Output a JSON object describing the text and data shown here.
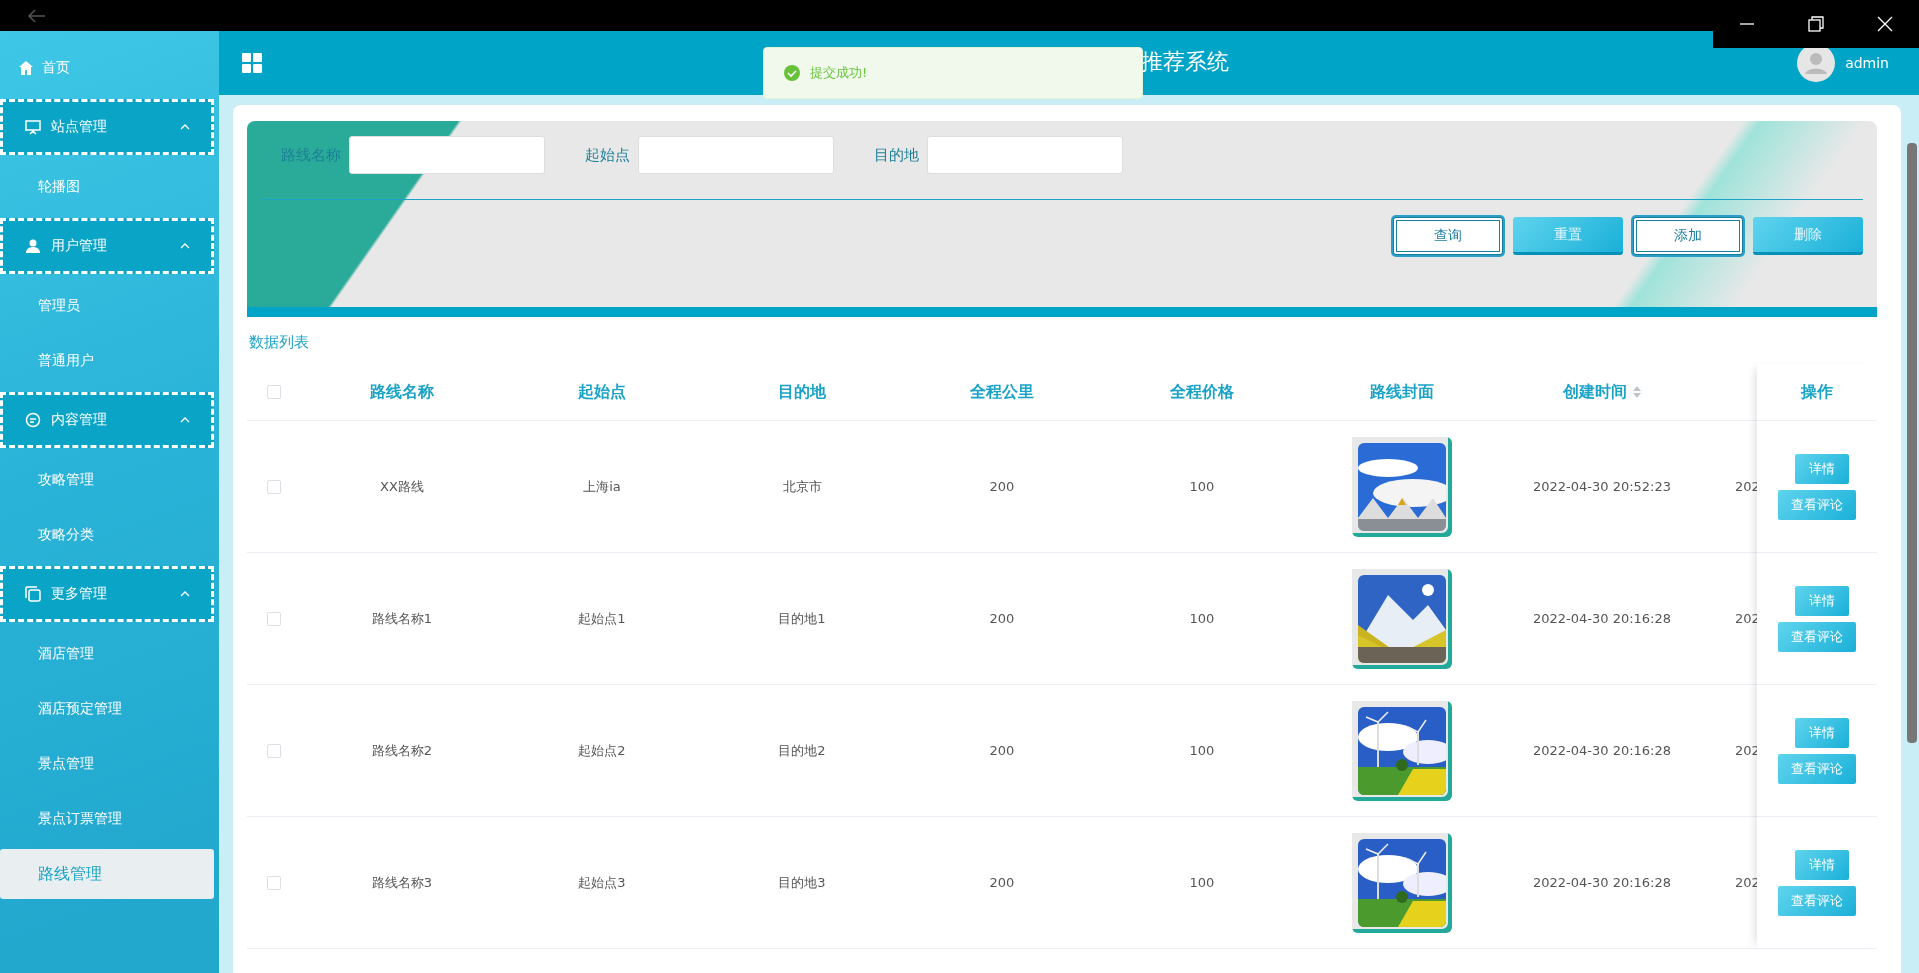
{
  "header": {
    "title": "推荐系统",
    "user": "admin"
  },
  "toast": {
    "kind": "success",
    "text": "提交成功!"
  },
  "sidebar": {
    "items": [
      {
        "kind": "link",
        "label": "首页"
      },
      {
        "kind": "group",
        "label": "站点管理",
        "expanded": true,
        "children": [
          {
            "label": "轮播图",
            "selected": false
          }
        ]
      },
      {
        "kind": "group",
        "label": "用户管理",
        "expanded": true,
        "children": [
          {
            "label": "管理员",
            "selected": false
          },
          {
            "label": "普通用户",
            "selected": false
          }
        ]
      },
      {
        "kind": "group",
        "label": "内容管理",
        "expanded": true,
        "children": [
          {
            "label": "攻略管理",
            "selected": false
          },
          {
            "label": "攻略分类",
            "selected": false
          }
        ]
      },
      {
        "kind": "group",
        "label": "更多管理",
        "expanded": true,
        "children": [
          {
            "label": "酒店管理",
            "selected": false
          },
          {
            "label": "酒店预定管理",
            "selected": false
          },
          {
            "label": "景点管理",
            "selected": false
          },
          {
            "label": "景点订票管理",
            "selected": false
          },
          {
            "label": "路线管理",
            "selected": true
          }
        ]
      }
    ]
  },
  "search": {
    "fields": [
      {
        "label": "路线名称"
      },
      {
        "label": "起始点"
      },
      {
        "label": "目的地"
      }
    ],
    "buttons": [
      {
        "label": "查询",
        "kind": "outline"
      },
      {
        "label": "重置",
        "kind": "filled"
      },
      {
        "label": "添加",
        "kind": "outline"
      },
      {
        "label": "删除",
        "kind": "filled"
      }
    ]
  },
  "table": {
    "title": "数据列表",
    "all_checked": false,
    "columns": [
      {
        "label": "路线名称"
      },
      {
        "label": "起始点"
      },
      {
        "label": "目的地"
      },
      {
        "label": "全程公里"
      },
      {
        "label": "全程价格"
      },
      {
        "label": "路线封面"
      },
      {
        "label": "创建时间",
        "sortable": true
      }
    ],
    "actions_column": "操作",
    "rows": [
      {
        "checked": false,
        "cells": [
          "XX路线",
          "上海ia",
          "北京市",
          "200",
          "100"
        ],
        "cover": {
          "kind": "picture"
        },
        "created": "2022-04-30 20:52:23",
        "column_8": "202",
        "actions": [
          "详情",
          "查看评论"
        ]
      },
      {
        "checked": false,
        "cells": [
          "路线名称1",
          "起始点1",
          "目的地1",
          "200",
          "100"
        ],
        "cover": {
          "kind": "picture"
        },
        "created": "2022-04-30 20:16:28",
        "column_8": "202",
        "actions": [
          "详情",
          "查看评论"
        ]
      },
      {
        "checked": false,
        "cells": [
          "路线名称2",
          "起始点2",
          "目的地2",
          "200",
          "100"
        ],
        "cover": {
          "kind": "picture"
        },
        "created": "2022-04-30 20:16:28",
        "column_8": "202",
        "actions": [
          "详情",
          "查看评论"
        ]
      },
      {
        "checked": false,
        "cells": [
          "路线名称3",
          "起始点3",
          "目的地3",
          "200",
          "100"
        ],
        "cover": {
          "kind": "picture"
        },
        "created": "2022-04-30 20:16:28",
        "column_8": "202",
        "actions": [
          "详情",
          "查看评论"
        ]
      }
    ]
  }
}
